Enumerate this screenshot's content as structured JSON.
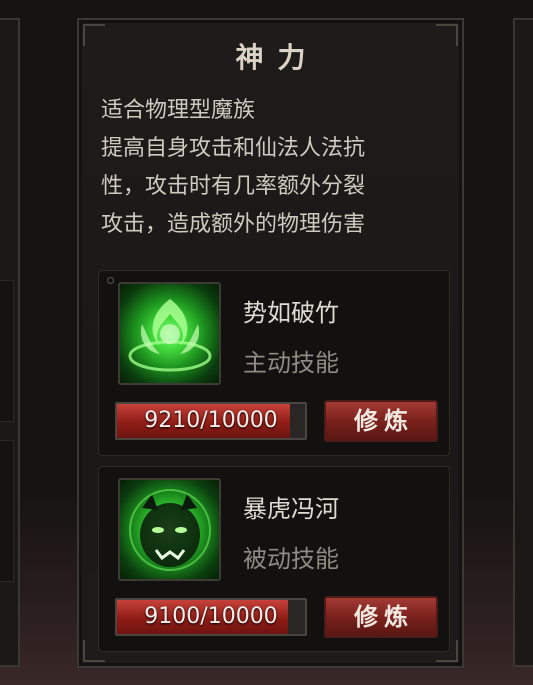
{
  "panel": {
    "title": "神力",
    "description_lines": [
      "适合物理型魔族",
      "提高自身攻击和仙法人法抗",
      "性，攻击时有几率额外分裂",
      "攻击，造成额外的物理伤害"
    ]
  },
  "skills": [
    {
      "name": "势如破竹",
      "type": "主动技能",
      "progress_text": "9210/10000",
      "progress_value": 9210,
      "progress_max": 10000,
      "button_label": "修炼",
      "icon": "green-flame-burst-icon"
    },
    {
      "name": "暴虎冯河",
      "type": "被动技能",
      "progress_text": "9100/10000",
      "progress_value": 9100,
      "progress_max": 10000,
      "button_label": "修炼",
      "icon": "green-beast-head-icon"
    }
  ],
  "colors": {
    "accent_red": "#8f1c16",
    "skill_green": "#3fd53a",
    "panel_bg": "#1e1c1a"
  }
}
